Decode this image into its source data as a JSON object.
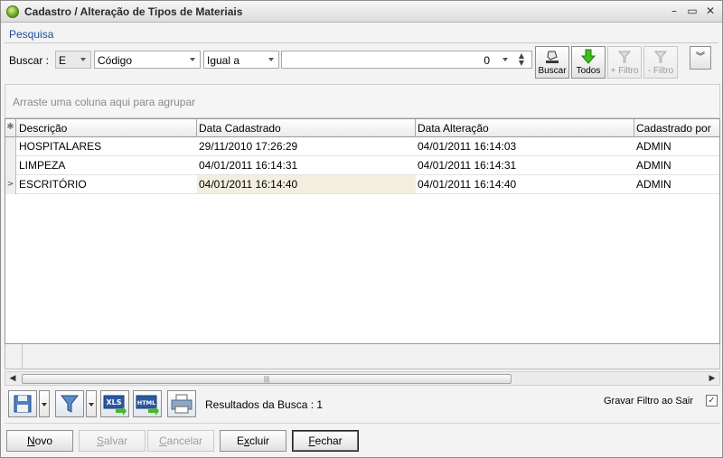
{
  "window": {
    "title": "Cadastro / Alteração de Tipos de Materiais",
    "controls": [
      "–",
      "▭",
      "✕"
    ]
  },
  "search": {
    "section_label": "Pesquisa",
    "label": "Buscar :",
    "logic_operator": "E",
    "field": "Código",
    "comparison": "Igual a",
    "value": "0",
    "buttons": {
      "buscar": "Buscar",
      "todos": "Todos",
      "add_filtro": "+ Filtro",
      "remove_filtro": "- Filtro"
    }
  },
  "group_panel": {
    "hint": "Arraste uma coluna aqui para agrupar"
  },
  "grid": {
    "columns": [
      "Descrição",
      "Data Cadastrado",
      "Data Alteração",
      "Cadastrado por"
    ],
    "rows": [
      [
        "HOSPITALARES",
        "29/11/2010 17:26:29",
        "04/01/2011 16:14:03",
        "ADMIN"
      ],
      [
        "LIMPEZA",
        "04/01/2011 16:14:31",
        "04/01/2011 16:14:31",
        "ADMIN"
      ],
      [
        "ESCRITÓRIO",
        "04/01/2011 16:14:40",
        "04/01/2011 16:14:40",
        "ADMIN"
      ]
    ],
    "focused_row": 2,
    "header_indicator": "✱"
  },
  "actions": {
    "result_label": "Resultados da Busca : 1",
    "save_filter_label": "Gravar Filtro ao Sair",
    "save_filter_checked": true,
    "export_xls": "XLS",
    "export_html": "HTML"
  },
  "footer_buttons": {
    "novo": {
      "prefix": "",
      "accel": "N",
      "rest": "ovo"
    },
    "salvar": {
      "prefix": "",
      "accel": "S",
      "rest": "alvar"
    },
    "cancelar": {
      "prefix": "",
      "accel": "C",
      "rest": "ancelar"
    },
    "excluir": {
      "prefix": "E",
      "accel": "x",
      "rest": "cluir"
    },
    "fechar": {
      "prefix": "",
      "accel": "F",
      "rest": "echar"
    }
  },
  "colors": {
    "accent_blue": "#1f4e9c",
    "focused_cell": "#f2efe0",
    "todos_arrow": "#3fbf1a"
  },
  "icons": [
    "app-leaf-icon",
    "eraser-search-icon",
    "green-down-arrow-icon",
    "filter-add-icon",
    "filter-remove-icon",
    "double-chevron-down-icon",
    "save-layout-icon",
    "filter-funnel-icon",
    "xls-export-icon",
    "html-export-icon",
    "printer-icon"
  ]
}
